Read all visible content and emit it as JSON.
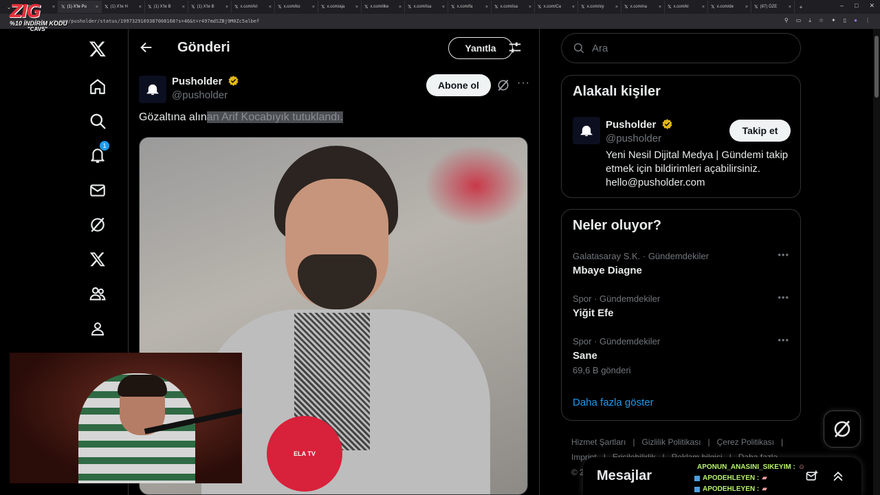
{
  "browser": {
    "tabs": [
      {
        "label": "Link Polis",
        "active": false
      },
      {
        "label": "(1) X'te Pu",
        "active": true
      },
      {
        "label": "(1) X'te H",
        "active": false
      },
      {
        "label": "(1) X'te B",
        "active": false
      },
      {
        "label": "(1) X'te B",
        "active": false
      },
      {
        "label": "x.com/Ari",
        "active": false
      },
      {
        "label": "x.com/ko",
        "active": false
      },
      {
        "label": "x.com/aja",
        "active": false
      },
      {
        "label": "x.com/ilke",
        "active": false
      },
      {
        "label": "x.com/Isa",
        "active": false
      },
      {
        "label": "x.com/fa",
        "active": false
      },
      {
        "label": "x.com/isa",
        "active": false
      },
      {
        "label": "x.com/Ca",
        "active": false
      },
      {
        "label": "x.com/siy",
        "active": false
      },
      {
        "label": "x.com/na",
        "active": false
      },
      {
        "label": "x.com/ki",
        "active": false
      },
      {
        "label": "x.com/de",
        "active": false
      },
      {
        "label": "(87) ÖZE",
        "active": false
      }
    ],
    "url": "x.com/pusholder/status/1997329169387008168?s=46&t=r497mdSZBj9M0Zc5albef"
  },
  "stream_overlay": {
    "logo_text": "ZIG",
    "promo_line": "%10 İNDİRİM KODU",
    "promo_code": "\"CAVS\""
  },
  "left_nav": {
    "notification_count": "1"
  },
  "header": {
    "title": "Gönderi",
    "reply_label": "Yanıtla"
  },
  "post": {
    "author_name": "Pusholder",
    "author_handle": "@pusholder",
    "subscribe_label": "Abone ol",
    "more_label": "···",
    "text_plain": "Gözaltına alın",
    "text_highlighted": "an Arif Kocabıyık tutuklandı.",
    "mic_label": "ELA TV"
  },
  "sidebar": {
    "search_placeholder": "Ara",
    "related": {
      "title": "Alakalı kişiler",
      "name": "Pusholder",
      "handle": "@pusholder",
      "bio": "Yeni Nesil Dijital Medya | Gündemi takip etmek için bildirimleri açabilirsiniz. hello@pusholder.com",
      "follow_label": "Takip et"
    },
    "trends": {
      "title": "Neler oluyor?",
      "items": [
        {
          "meta": "Galatasaray S.K. · Gündemdekiler",
          "name": "Mbaye Diagne",
          "count": ""
        },
        {
          "meta": "Spor · Gündemdekiler",
          "name": "Yiğit Efe",
          "count": ""
        },
        {
          "meta": "Spor · Gündemdekiler",
          "name": "Sane",
          "count": "69,6 B gönderi"
        }
      ],
      "show_more": "Daha fazla göster"
    },
    "footer": {
      "links": [
        "Hizmet Şartları",
        "|",
        "Gizlilik Politikası",
        "|",
        "Çerez Politikası",
        "|",
        "Imprint",
        "|",
        "Erişilebilirlik",
        "|",
        "Reklam bilgisi",
        "|",
        "Daha fazla ···"
      ],
      "copyright": "© 20"
    }
  },
  "messages": {
    "title": "Mesajlar"
  },
  "chat": {
    "lines": [
      {
        "user": "APONUN_ANASINI_SIKEYIM :",
        "emote": "☺"
      },
      {
        "user": "APODEHLEYEN :",
        "emote": "▰"
      },
      {
        "user": "APODEHLEYEN :",
        "emote": "▰"
      }
    ]
  },
  "colors": {
    "background": "#000000",
    "text": "#e7e9ea",
    "muted": "#71767b",
    "accent": "#1d9bf0",
    "verified": "#e2b719",
    "border": "#2f3336"
  }
}
